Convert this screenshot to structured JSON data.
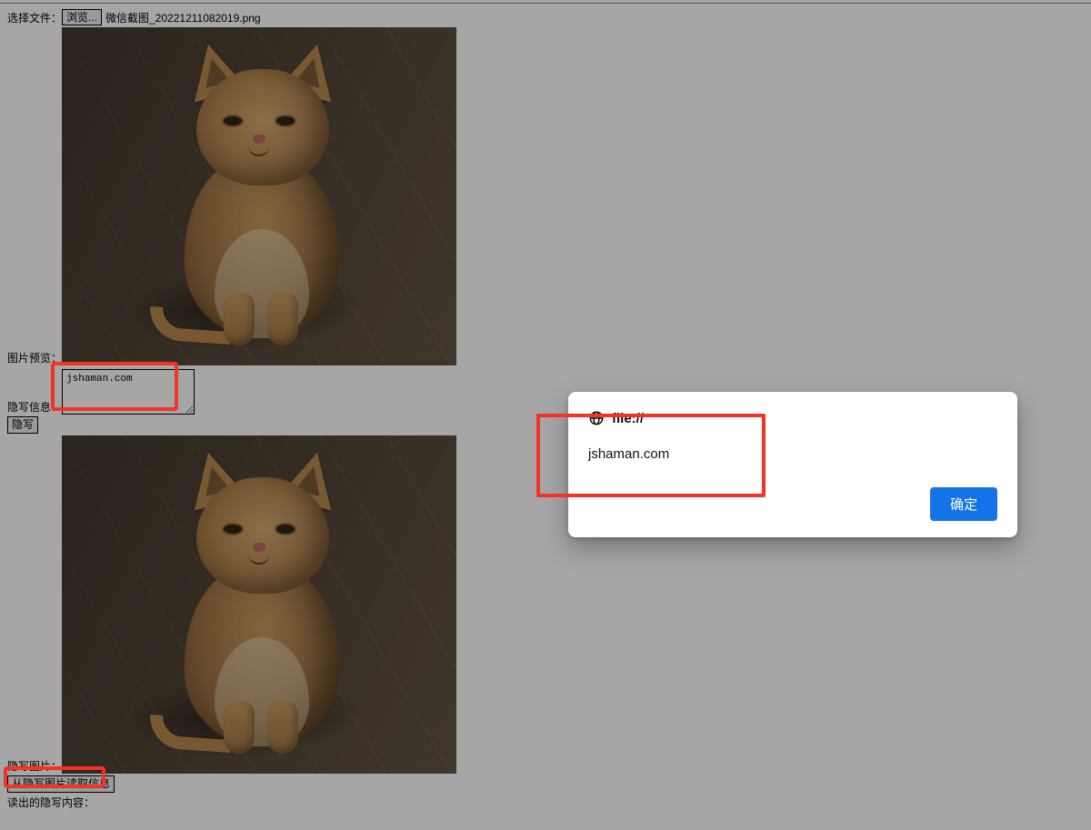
{
  "labels": {
    "select_file": "选择文件：",
    "browse": "浏览...",
    "preview": "图片预览：",
    "stego_info": "隐写信息：",
    "stego_btn": "隐写",
    "stego_image": "隐写图片：",
    "read_btn": "从隐写图片读取信息",
    "read_content": "读出的隐写内容："
  },
  "filename": "微信截图_20221211082019.png",
  "textarea_value": "jshaman.com",
  "dialog": {
    "origin": "file://",
    "message": "jshaman.com",
    "ok": "确定"
  }
}
